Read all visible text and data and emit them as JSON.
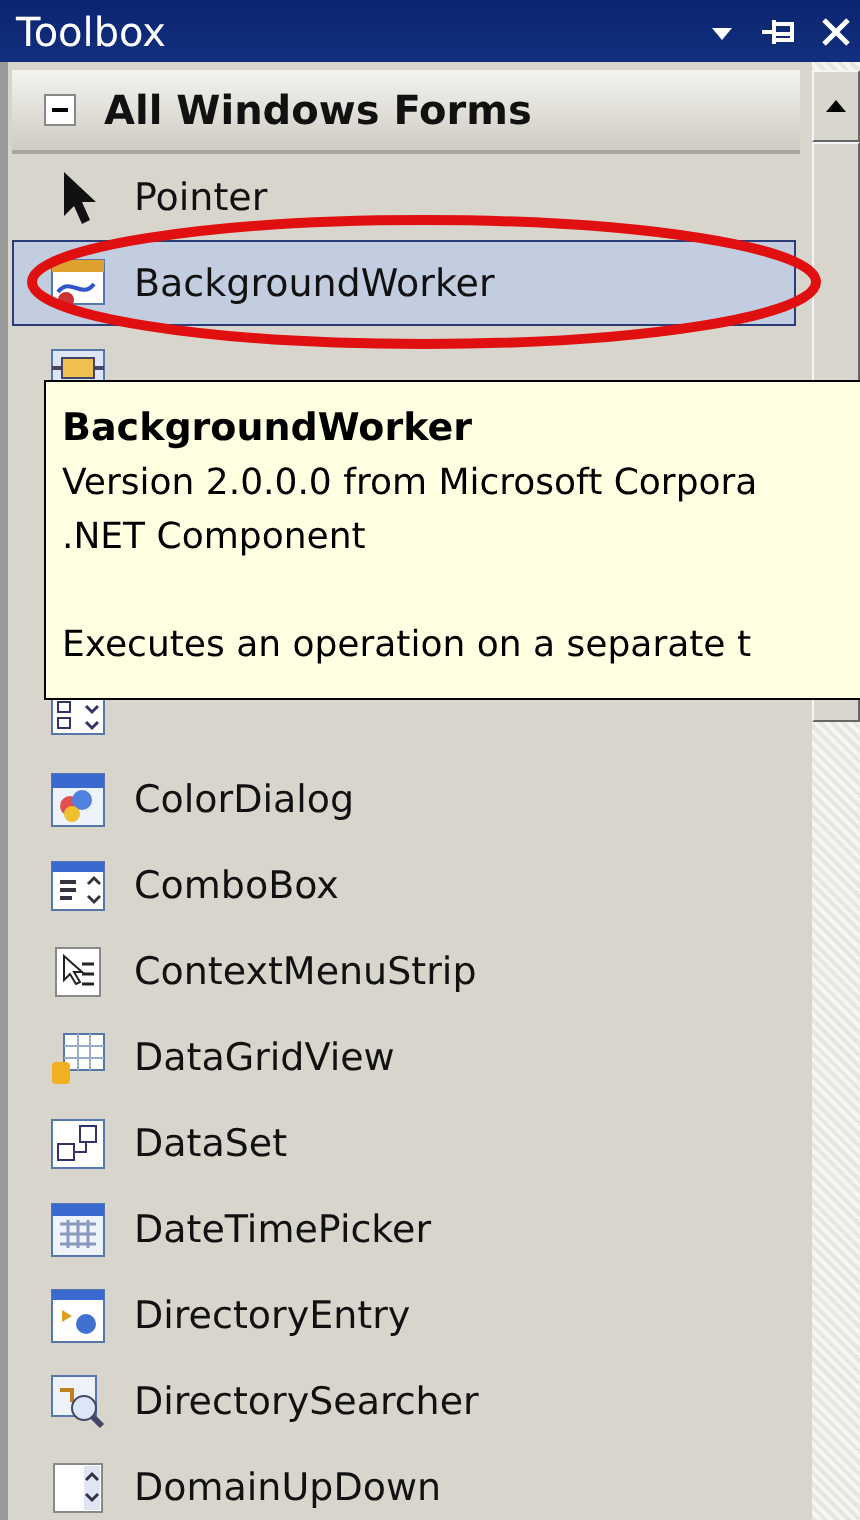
{
  "window": {
    "title": "Toolbox"
  },
  "group": {
    "label": "All Windows Forms",
    "expanded": true
  },
  "items": [
    {
      "label": "Pointer",
      "kind": "pointer",
      "selected": false,
      "circled": false
    },
    {
      "label": "BackgroundWorker",
      "kind": "component",
      "selected": true,
      "circled": true
    },
    {
      "kind": "component",
      "selected": false,
      "circled": false,
      "tooltip": {
        "title": "BackgroundWorker",
        "lines": [
          "Version 2.0.0.0 from Microsoft Corpora",
          ".NET Component"
        ],
        "description": "Executes an operation on a separate t"
      }
    },
    {
      "kind": "component",
      "selected": false,
      "circled": false
    },
    {
      "label": "ColorDialog",
      "kind": "component",
      "selected": false,
      "circled": false
    },
    {
      "label": "ComboBox",
      "kind": "component",
      "selected": false,
      "circled": false
    },
    {
      "label": "ContextMenuStrip",
      "kind": "component",
      "selected": false,
      "circled": false
    },
    {
      "label": "DataGridView",
      "kind": "component",
      "selected": false,
      "circled": false
    },
    {
      "label": "DataSet",
      "kind": "component",
      "selected": false,
      "circled": false
    },
    {
      "label": "DateTimePicker",
      "kind": "component",
      "selected": false,
      "circled": false
    },
    {
      "label": "DirectoryEntry",
      "kind": "component",
      "selected": false,
      "circled": false
    },
    {
      "label": "DirectorySearcher",
      "kind": "component",
      "selected": false,
      "circled": false
    },
    {
      "label": "DomainUpDown",
      "kind": "component",
      "selected": false,
      "circled": false
    }
  ]
}
